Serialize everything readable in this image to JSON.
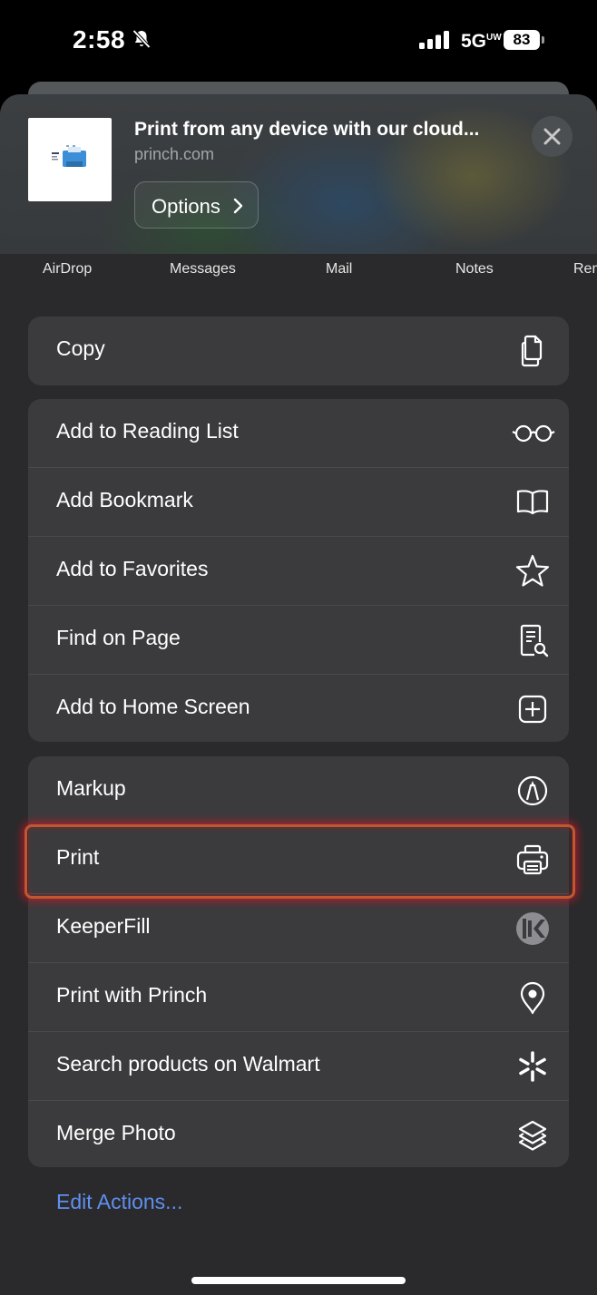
{
  "status_bar": {
    "time": "2:58",
    "network": "5G",
    "network_sup": "UW",
    "battery": "83"
  },
  "preview": {
    "title": "Print from any device with our cloud...",
    "domain": "princh.com",
    "options_label": "Options"
  },
  "apps": [
    "AirDrop",
    "Messages",
    "Mail",
    "Notes",
    "Rem"
  ],
  "groups": [
    {
      "rows": [
        {
          "label": "Copy",
          "icon": "copy-icon"
        }
      ]
    },
    {
      "rows": [
        {
          "label": "Add to Reading List",
          "icon": "glasses-icon"
        },
        {
          "label": "Add Bookmark",
          "icon": "book-icon"
        },
        {
          "label": "Add to Favorites",
          "icon": "star-icon"
        },
        {
          "label": "Find on Page",
          "icon": "find-document-icon"
        },
        {
          "label": "Add to Home Screen",
          "icon": "plus-square-icon"
        }
      ]
    },
    {
      "rows": [
        {
          "label": "Markup",
          "icon": "markup-icon"
        },
        {
          "label": "Print",
          "icon": "printer-icon"
        },
        {
          "label": "KeeperFill",
          "icon": "keeper-icon"
        },
        {
          "label": "Print with Princh",
          "icon": "location-pin-icon"
        },
        {
          "label": "Search products on Walmart",
          "icon": "walmart-spark-icon"
        },
        {
          "label": "Merge Photo",
          "icon": "layers-icon"
        }
      ]
    }
  ],
  "edit_actions": "Edit Actions...",
  "colors": {
    "sheet": "#2a2a2c",
    "row": "#3b3b3d",
    "link": "#5f8ff0",
    "highlight": "#c0572e"
  }
}
